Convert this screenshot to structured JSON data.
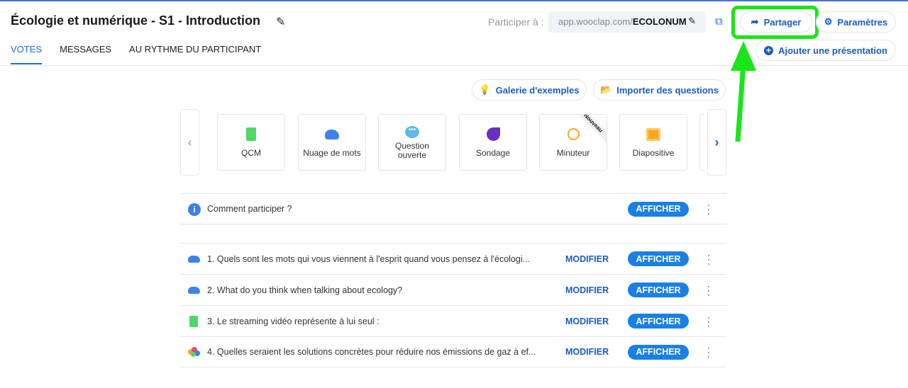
{
  "header": {
    "title": "Écologie et numérique - S1 - Introduction",
    "participate_label": "Participer à :",
    "url_prefix": "app.wooclap.com/",
    "url_code": "ECOLONUM"
  },
  "tabs": [
    {
      "label": "VOTES",
      "active": true
    },
    {
      "label": "MESSAGES"
    },
    {
      "label": "AU RYTHME DU PARTICIPANT"
    }
  ],
  "actions": {
    "share": "Partager",
    "settings": "Paramètres",
    "add_presentation": "Ajouter une présentation",
    "gallery": "Galerie d'exemples",
    "import": "Importer des questions"
  },
  "question_types": [
    {
      "label": "QCM"
    },
    {
      "label": "Nuage de mots"
    },
    {
      "label": "Question ouverte"
    },
    {
      "label": "Sondage"
    },
    {
      "label": "Minuteur",
      "badge": "Nouveau"
    },
    {
      "label": "Diapositive"
    }
  ],
  "intro_row": {
    "label": "Comment participer ?",
    "button": "AFFICHER"
  },
  "questions": [
    {
      "text": "1.  Quels sont les mots qui vous viennent à l'esprit quand vous pensez à l'écologi...",
      "type": "cloud"
    },
    {
      "text": "2.  What do you think when talking about ecology?",
      "type": "cloud"
    },
    {
      "text": "3.  Le streaming vidéo représente à lui seul :",
      "type": "mcq"
    },
    {
      "text": "4.  Quelles seraient les solutions concrètes pour réduire nos émissions de gaz à ef...",
      "type": "multi"
    }
  ],
  "row_actions": {
    "modify": "MODIFIER",
    "show": "AFFICHER"
  },
  "colors": {
    "accent": "#1a5cc8",
    "button": "#1a7fe6",
    "highlight": "#19e619"
  }
}
